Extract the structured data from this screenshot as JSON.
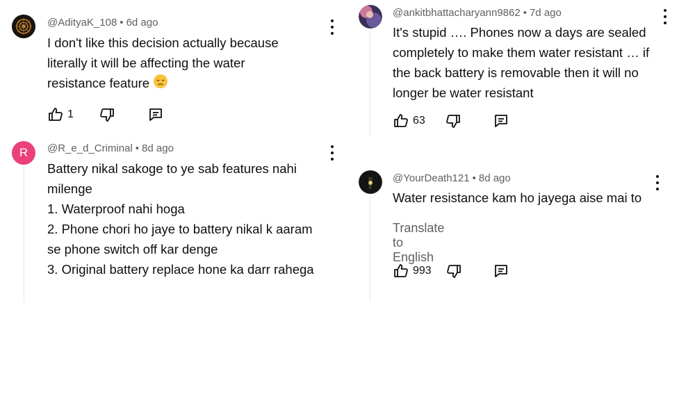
{
  "comments": [
    {
      "author": "@AdityaK_108",
      "time": "6d ago",
      "text": "I don't like this decision actually because literally it will be affecting the water resistance feature",
      "emoji": "disappointed-face",
      "likes": "1",
      "avatar": {
        "type": "image",
        "color": "#1a1410"
      }
    },
    {
      "author": "@R_e_d_Criminal",
      "time": "8d ago",
      "lines": [
        "Battery nikal sakoge to ye sab features nahi milenge",
        "1. Waterproof nahi hoga",
        "2. Phone chori ho jaye to battery nikal k aaram se phone switch off kar denge",
        "3. Original battery replace hone ka darr rahega"
      ],
      "avatar": {
        "type": "letter",
        "letter": "R",
        "color": "#ec407a"
      }
    },
    {
      "author": "@ankitbhattacharyann9862",
      "time": "7d ago",
      "text": "It's stupid …. Phones now a days are sealed completely to make them water resistant … if the back battery is removable then it will no longer be water resistant",
      "likes": "63",
      "avatar": {
        "type": "image",
        "color": "#6a5a9a"
      }
    },
    {
      "author": "@YourDeath121",
      "time": "8d ago",
      "text": "Water resistance kam ho jayega aise mai to",
      "translate": "Translate to English",
      "likes": "993",
      "avatar": {
        "type": "image",
        "color": "#141414"
      }
    }
  ],
  "meta_separator": "•",
  "colors": {
    "text": "#0f0f0f",
    "secondary": "#606060",
    "line": "#e5e5e5"
  }
}
